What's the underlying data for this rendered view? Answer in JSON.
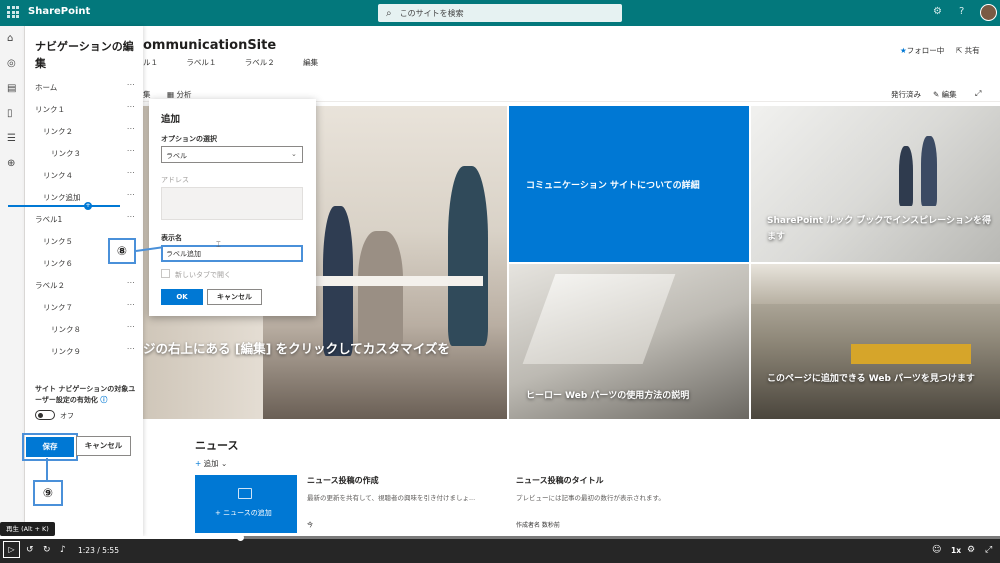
{
  "topbar": {
    "brand": "SharePoint",
    "search_placeholder": "このサイトを検索"
  },
  "site": {
    "title": "ommunicationSite",
    "nav": [
      "ル１",
      "ラベル１",
      "ラベル２",
      "編集"
    ],
    "follow": "フォロー中",
    "share": "共有",
    "cmd_left": "集",
    "cmd_analytics": "分析",
    "cmd_published": "発行済み",
    "cmd_edit": "編集"
  },
  "navpanel": {
    "title": "ナビゲーションの編集",
    "items": [
      {
        "label": "ホーム"
      },
      {
        "label": "リンク１"
      },
      {
        "label": "リンク２"
      },
      {
        "label": "リンク３"
      },
      {
        "label": "リンク４"
      },
      {
        "label": "リンク追加"
      },
      {
        "label": "ラベル1"
      },
      {
        "label": "リンク５"
      },
      {
        "label": "リンク６"
      },
      {
        "label": "ラベル２"
      },
      {
        "label": "リンク７"
      },
      {
        "label": "リンク８"
      },
      {
        "label": "リンク９"
      }
    ],
    "dots": "···",
    "audience_label": "サイト ナビゲーションの対象ユーザー設定の有効化",
    "toggle_label": "オフ",
    "save": "保存",
    "cancel": "キャンセル"
  },
  "dialog": {
    "title": "追加",
    "option_label": "オプションの選択",
    "option_value": "ラベル",
    "address_label": "アドレス",
    "display_name_label": "表示名",
    "display_name_value": "ラベル追加",
    "new_tab_label": "新しいタブで開く",
    "ok": "OK",
    "cancel": "キャンセル"
  },
  "callouts": {
    "step8": "⑧",
    "step9": "⑨"
  },
  "hero": {
    "main_caption": "ジの右上にある [編集] をクリックしてカスタマイズを",
    "tile_blue": "コミュニケーション サイトについての詳細",
    "tile_top_right": "SharePoint ルック ブックでインスピレーションを得ます",
    "tile_bottom_left": "ヒーロー Web パーツの使用方法の説明",
    "tile_bottom_right": "このページに追加できる Web パーツを見つけます"
  },
  "news": {
    "title": "ニュース",
    "add": "追加",
    "tile_text": "ニュースの追加",
    "items": [
      {
        "title": "ニュース投稿の作成",
        "desc": "最新の更新を共有して、視聴者の興味を引き付けましょ...",
        "author": "今"
      },
      {
        "title": "ニュース投稿のタイトル",
        "desc": "プレビューには記事の最初の数行が表示されます。",
        "author": "作成者名 数秒前"
      }
    ]
  },
  "video": {
    "tooltip": "再生 (Alt + K)",
    "time": "1:23 / 5:55",
    "progress": 0.24,
    "speed": "1x"
  },
  "colors": {
    "suite_bar": "#03787c",
    "accent": "#0078d4",
    "callout": "#4a90d9"
  }
}
